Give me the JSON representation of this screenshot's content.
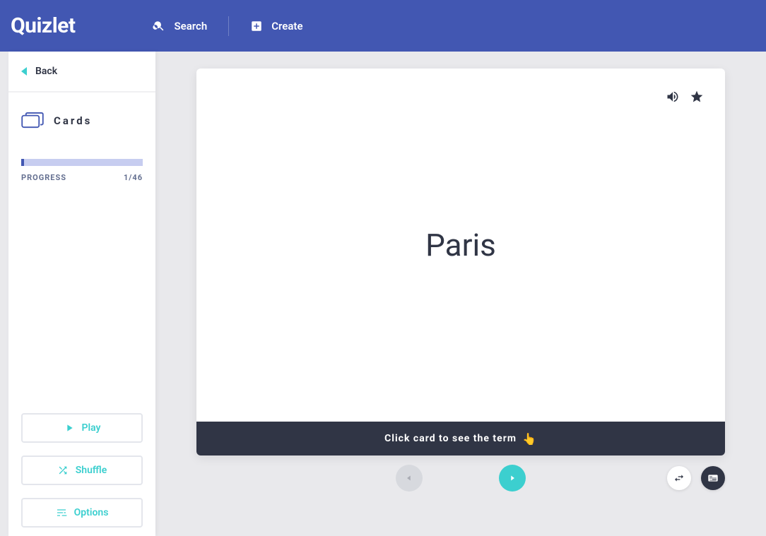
{
  "header": {
    "logo_text": "Quizlet",
    "search_label": "Search",
    "create_label": "Create"
  },
  "sidebar": {
    "back_label": "Back",
    "mode_label": "Cards",
    "progress_label": "PROGRESS",
    "progress_text": "1/46",
    "progress_current": 1,
    "progress_total": 46,
    "play_label": "Play",
    "shuffle_label": "Shuffle",
    "options_label": "Options"
  },
  "card": {
    "term": "Paris",
    "hint_text": "Click card to see the term",
    "hint_emoji": "👆"
  },
  "icons": {
    "audio": "audio-icon",
    "star": "star-icon",
    "swap": "swap-icon",
    "keyboard": "keyboard-icon"
  }
}
